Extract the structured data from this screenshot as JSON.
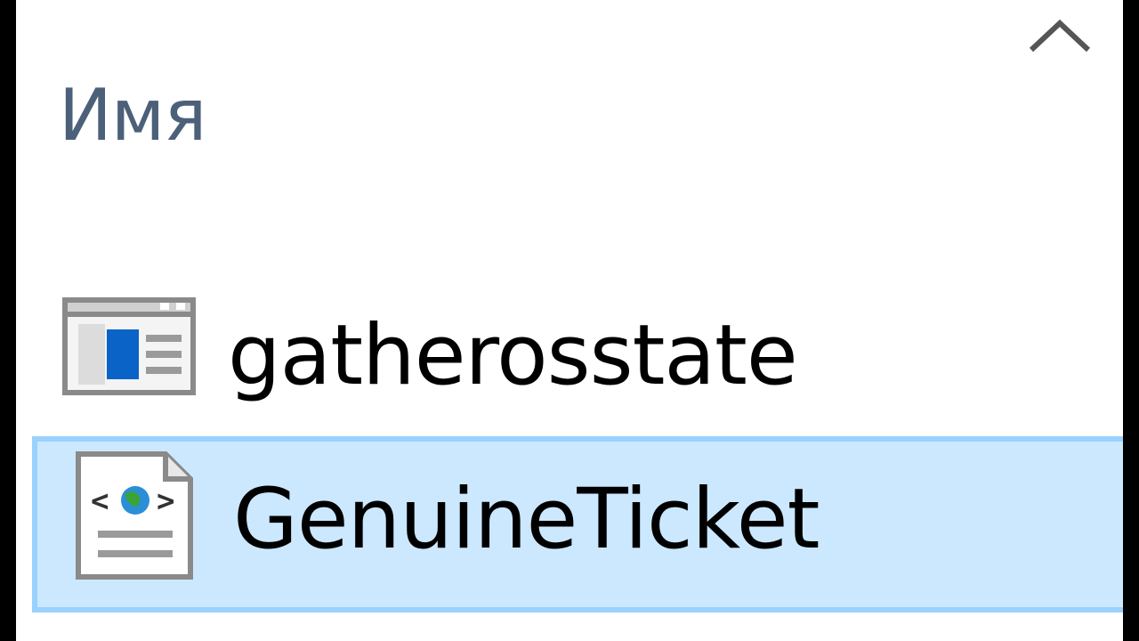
{
  "list": {
    "column_header": "Имя",
    "sort_icon": "chevron-up-icon",
    "items": [
      {
        "name": "gatherosstate",
        "icon": "application-icon",
        "selected": false
      },
      {
        "name": "GenuineTicket",
        "icon": "xml-document-icon",
        "selected": true
      }
    ]
  },
  "colors": {
    "selection_fill": "#cce8ff",
    "selection_border": "#99d1ff",
    "header_text": "#4c607a"
  }
}
